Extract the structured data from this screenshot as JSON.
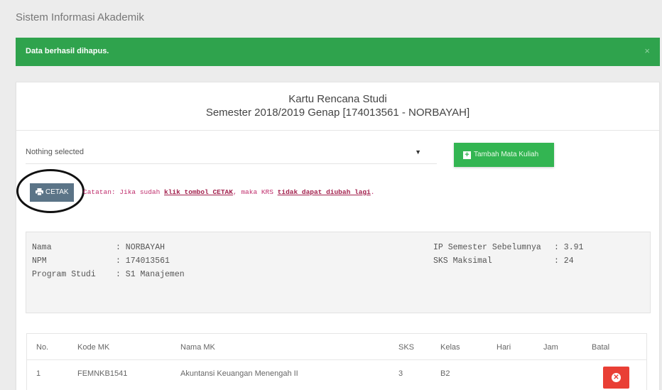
{
  "app": {
    "title": "Sistem Informasi Akademik"
  },
  "alert": {
    "message": "Data berhasil dihapus.",
    "close": "×"
  },
  "krs": {
    "title": "Kartu Rencana Studi",
    "subtitle": "Semester 2018/2019 Genap [174013561 - NORBAYAH]"
  },
  "select": {
    "value": "Nothing selected",
    "caret": "▼"
  },
  "add_button": {
    "label": "Tambah Mata Kuliah"
  },
  "print_button": {
    "label": "CETAK"
  },
  "note": {
    "prefix": "Catatan: Jika sudah ",
    "link1": "klik tombol CETAK",
    "middle": ", maka KRS ",
    "link2": "tidak dapat diubah lagi",
    "suffix": "."
  },
  "student": {
    "nama_label": "Nama",
    "nama": ": NORBAYAH",
    "npm_label": "NPM",
    "npm": ": 174013561",
    "prodi_label": "Program Studi",
    "prodi": ": S1 Manajemen",
    "ip_label": "IP Semester Sebelumnya",
    "ip": ": 3.91",
    "sks_label": "SKS Maksimal",
    "sks": ": 24"
  },
  "table": {
    "headers": [
      "No.",
      "Kode MK",
      "Nama MK",
      "SKS",
      "Kelas",
      "Hari",
      "Jam",
      "Batal"
    ],
    "rows": [
      {
        "no": "1",
        "kode": "FEMNKB1541",
        "nama": "Akuntansi Keuangan Menengah II",
        "sks": "3",
        "kelas": "B2",
        "hari": "",
        "jam": ""
      }
    ]
  },
  "colors": {
    "success": "#2fa34d",
    "add": "#33b552",
    "print": "#5b7487",
    "danger": "#e93f35",
    "note": "#c0306e"
  }
}
